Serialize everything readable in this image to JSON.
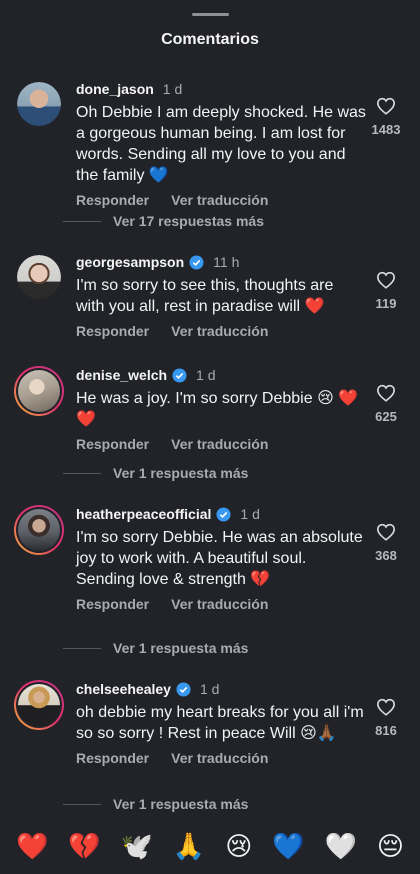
{
  "header": {
    "title": "Comentarios"
  },
  "actions": {
    "reply": "Responder",
    "translate": "Ver traducción"
  },
  "comments": [
    {
      "username": "done_jason",
      "verified": false,
      "time": "1 d",
      "text": "Oh Debbie I am deeply shocked. He was a gorgeous human being. I am lost for words. Sending all my love to you and the family 💙",
      "likes": "1483",
      "more_replies": "Ver 17 respuestas más"
    },
    {
      "username": "georgesampson",
      "verified": true,
      "time": "11 h",
      "text": "I'm so sorry to see this, thoughts are with you all, rest in paradise will ❤️",
      "likes": "119",
      "more_replies": ""
    },
    {
      "username": "denise_welch",
      "verified": true,
      "time": "1 d",
      "text": "He was a joy. I'm so sorry Debbie 😢 ❤️❤️",
      "likes": "625",
      "more_replies": "Ver 1 respuesta más"
    },
    {
      "username": "heatherpeaceofficial",
      "verified": true,
      "time": "1 d",
      "text": "I'm so sorry Debbie. He was an absolute joy to work with. A beautiful soul. Sending love & strength 💔",
      "likes": "368",
      "more_replies": "Ver 1 respuesta más"
    },
    {
      "username": "chelseehealey",
      "verified": true,
      "time": "1 d",
      "text": "oh debbie my heart breaks for you all i'm so so sorry ! Rest in peace Will 😢🙏🏾",
      "likes": "816",
      "more_replies": "Ver 1 respuesta más"
    }
  ],
  "emoji_bar": [
    "❤️",
    "💔",
    "🕊️",
    "🙏",
    "😢",
    "💙",
    "🤍",
    "😔"
  ],
  "colors": {
    "background": "#212328",
    "verified": "#3897f0",
    "text_secondary": "#a8abb1"
  }
}
